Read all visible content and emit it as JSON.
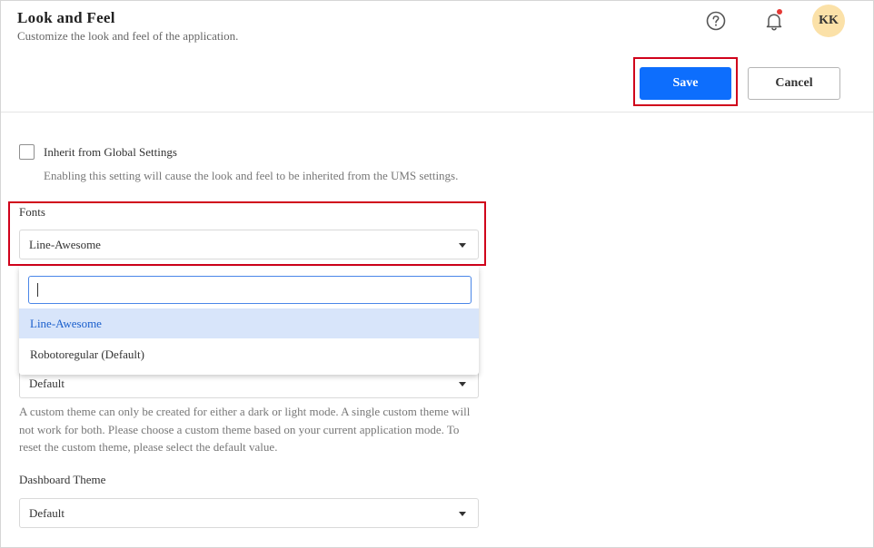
{
  "header": {
    "title": "Look and Feel",
    "subtitle": "Customize the look and feel of the application.",
    "avatar_initials": "KK"
  },
  "actions": {
    "save_label": "Save",
    "cancel_label": "Cancel"
  },
  "inherit": {
    "label": "Inherit from Global Settings",
    "checked": false,
    "help": "Enabling this setting will cause the look and feel to be inherited from the UMS settings."
  },
  "fonts": {
    "label": "Fonts",
    "selected": "Line-Awesome",
    "search_value": "",
    "options": [
      "Line-Awesome",
      "Robotoregular (Default)"
    ]
  },
  "theme": {
    "selected": "Default",
    "help": "A custom theme can only be created for either a dark or light mode. A single custom theme will not work for both. Please choose a custom theme based on your current application mode. To reset the custom theme, please select the default value."
  },
  "dashboard_theme": {
    "label": "Dashboard Theme",
    "selected": "Default"
  },
  "colors": {
    "primary": "#0d6efd",
    "highlight": "#d0021b",
    "avatar_bg": "#fbe1a8",
    "notification_dot": "#e53935",
    "selected_option_bg": "#d8e5fa"
  },
  "icons": [
    "help-icon",
    "bell-icon",
    "caret-down-icon"
  ]
}
